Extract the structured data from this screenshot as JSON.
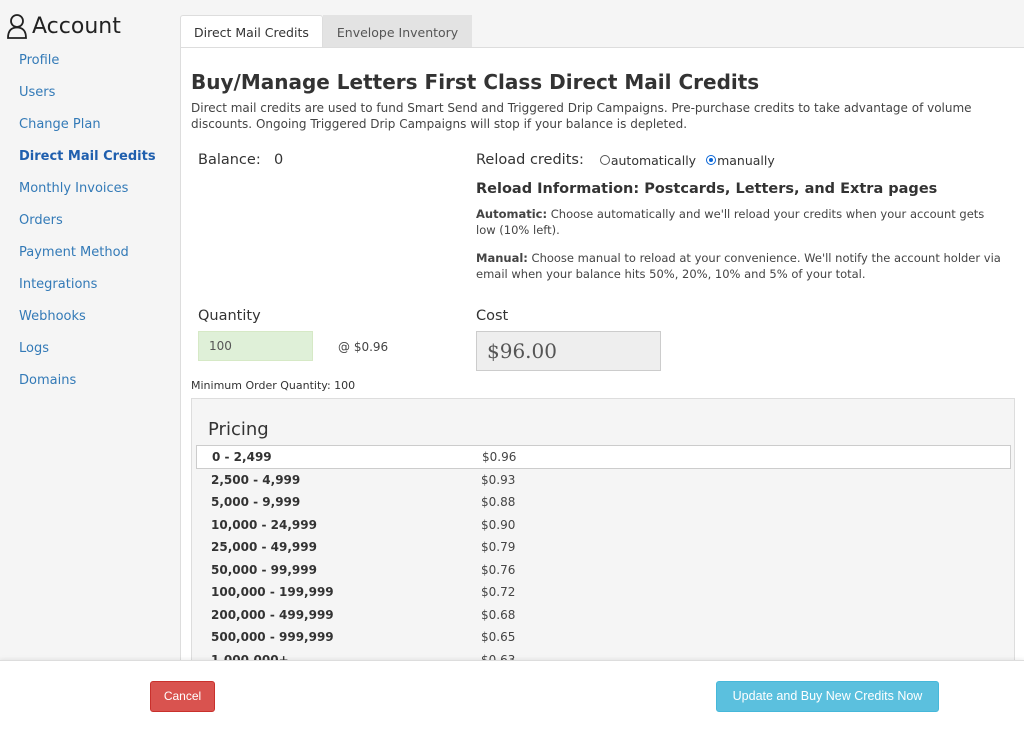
{
  "sidebar": {
    "title": "Account",
    "icon": "user-icon",
    "items": [
      {
        "label": "Profile"
      },
      {
        "label": "Users"
      },
      {
        "label": "Change Plan"
      },
      {
        "label": "Direct Mail Credits",
        "active": true
      },
      {
        "label": "Monthly Invoices"
      },
      {
        "label": "Orders"
      },
      {
        "label": "Payment Method"
      },
      {
        "label": "Integrations"
      },
      {
        "label": "Webhooks"
      },
      {
        "label": "Logs"
      },
      {
        "label": "Domains"
      }
    ]
  },
  "tabs": [
    {
      "label": "Direct Mail Credits",
      "active": true
    },
    {
      "label": "Envelope Inventory",
      "active": false
    }
  ],
  "main": {
    "heading": "Buy/Manage Letters First Class Direct Mail Credits",
    "description": "Direct mail credits are used to fund Smart Send and Triggered Drip Campaigns. Pre-purchase credits to take advantage of volume discounts. Ongoing Triggered Drip Campaigns will stop if your balance is depleted.",
    "balance_label": "Balance:",
    "balance_value": "0",
    "reload_label": "Reload credits:",
    "reload_options": [
      {
        "label": "automatically",
        "selected": false
      },
      {
        "label": "manually",
        "selected": true
      }
    ],
    "reload_info_title": "Reload Information: Postcards, Letters, and Extra pages",
    "automatic_label": "Automatic:",
    "automatic_text": " Choose automatically and we'll reload your credits when your account gets low (10% left).",
    "manual_label": "Manual:",
    "manual_text": " Choose manual to reload at your convenience. We'll notify the account holder via email when your balance hits 50%, 20%, 10% and 5% of your total.",
    "quantity_label": "Quantity",
    "quantity_value": "100",
    "price_each": "@ $0.96",
    "cost_label": "Cost",
    "cost_value": "$96.00",
    "min_order": "Minimum Order Quantity: 100"
  },
  "pricing": {
    "title": "Pricing",
    "rows": [
      {
        "range": "0 - 2,499",
        "price": "$0.96",
        "highlighted": true
      },
      {
        "range": "2,500 - 4,999",
        "price": "$0.93"
      },
      {
        "range": "5,000 - 9,999",
        "price": "$0.88"
      },
      {
        "range": "10,000 - 24,999",
        "price": "$0.90"
      },
      {
        "range": "25,000 - 49,999",
        "price": "$0.79"
      },
      {
        "range": "50,000 - 99,999",
        "price": "$0.76"
      },
      {
        "range": "100,000 - 199,999",
        "price": "$0.72"
      },
      {
        "range": "200,000 - 499,999",
        "price": "$0.68"
      },
      {
        "range": "500,000 - 999,999",
        "price": "$0.65"
      },
      {
        "range": "1,000,000+",
        "price": "$0.63"
      }
    ]
  },
  "footer": {
    "cancel_label": "Cancel",
    "update_label": "Update and Buy New Credits Now"
  },
  "colors": {
    "link": "#337ab7",
    "cancel": "#d9534f",
    "update": "#5bc0de",
    "quantity_bg": "#dff0d8"
  }
}
